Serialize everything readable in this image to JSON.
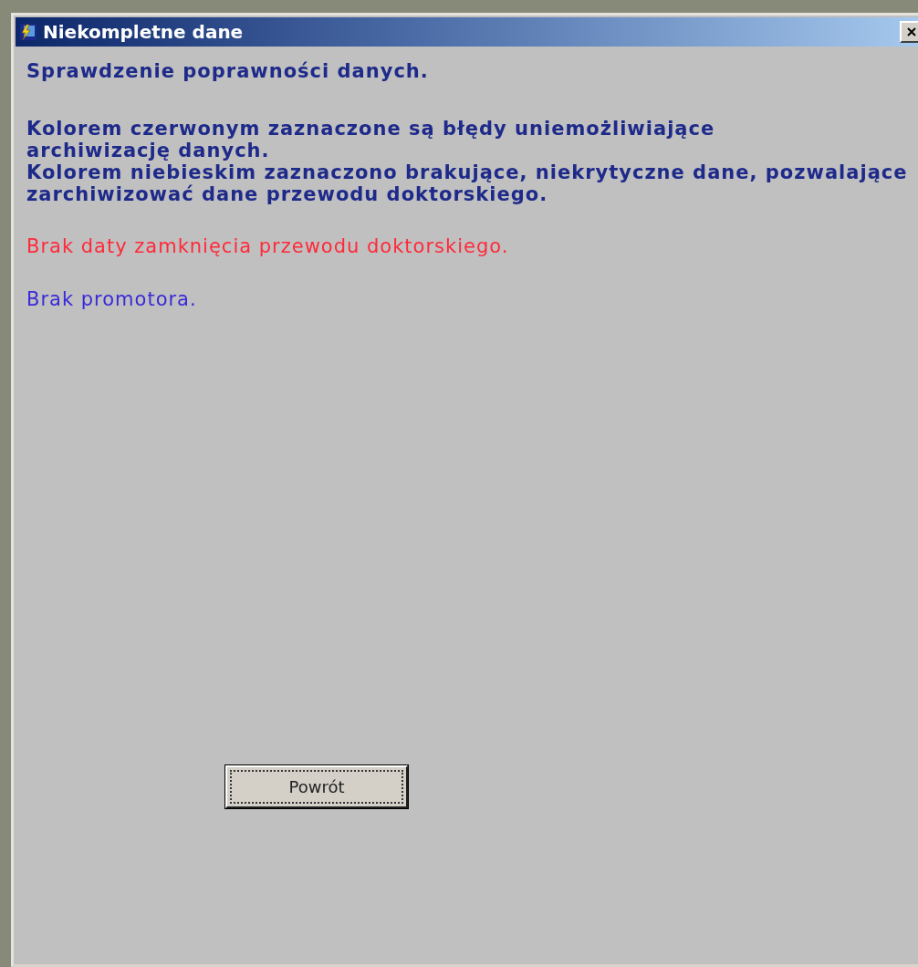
{
  "window": {
    "title": "Niekompletne dane"
  },
  "heading": "Sprawdzenie poprawności danych.",
  "paragraphs": [
    "Kolorem czerwonym zaznaczone są błędy uniemożliwiające\narchiwizację danych.\nKolorem niebieskim zaznaczono brakujące, niekrytyczne dane, pozwalające\nzarchiwizować dane przewodu doktorskiego."
  ],
  "messages": [
    {
      "kind": "critical",
      "text": "Brak daty zamknięcia przewodu doktorskiego."
    },
    {
      "kind": "noncritical",
      "text": "Brak promotora."
    }
  ],
  "buttons": [
    {
      "label": "Powrót"
    }
  ]
}
